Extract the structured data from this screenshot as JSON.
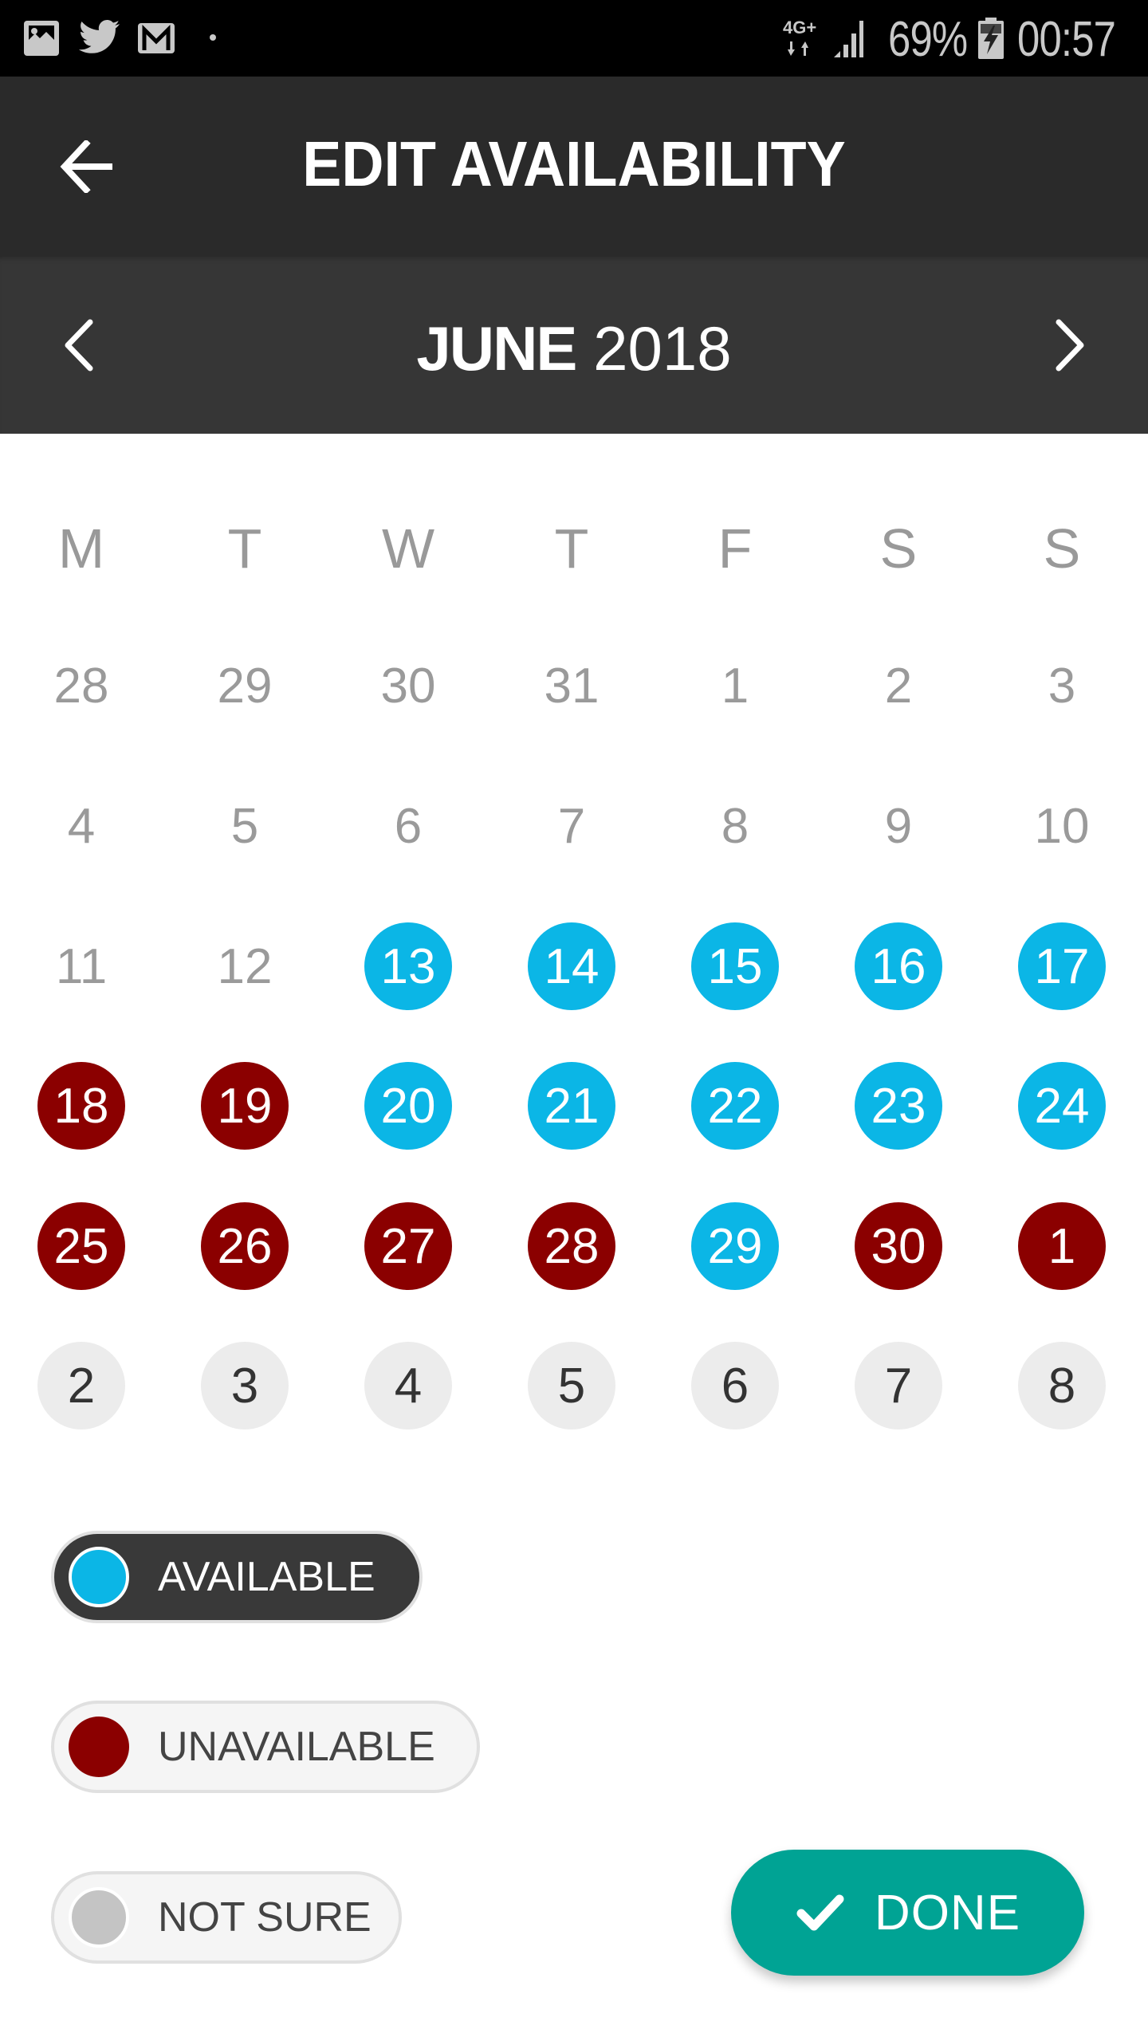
{
  "status_bar": {
    "left_icons": [
      "gallery-icon",
      "twitter-icon",
      "gmail-icon",
      "dot-icon"
    ],
    "network": "4G+",
    "battery_percent": "69%",
    "time": "00:57"
  },
  "header": {
    "title": "EDIT AVAILABILITY",
    "back_icon": "arrow-left-icon"
  },
  "month_bar": {
    "month": "JUNE",
    "year": "2018",
    "prev_icon": "chevron-left-icon",
    "next_icon": "chevron-right-icon"
  },
  "calendar": {
    "weekdays": [
      "M",
      "T",
      "W",
      "T",
      "F",
      "S",
      "S"
    ],
    "weeks": [
      [
        {
          "day": "28",
          "status": "muted"
        },
        {
          "day": "29",
          "status": "muted"
        },
        {
          "day": "30",
          "status": "muted"
        },
        {
          "day": "31",
          "status": "muted"
        },
        {
          "day": "1",
          "status": "muted"
        },
        {
          "day": "2",
          "status": "muted"
        },
        {
          "day": "3",
          "status": "muted"
        }
      ],
      [
        {
          "day": "4",
          "status": "muted"
        },
        {
          "day": "5",
          "status": "muted"
        },
        {
          "day": "6",
          "status": "muted"
        },
        {
          "day": "7",
          "status": "muted"
        },
        {
          "day": "8",
          "status": "muted"
        },
        {
          "day": "9",
          "status": "muted"
        },
        {
          "day": "10",
          "status": "muted"
        }
      ],
      [
        {
          "day": "11",
          "status": "muted"
        },
        {
          "day": "12",
          "status": "muted"
        },
        {
          "day": "13",
          "status": "available"
        },
        {
          "day": "14",
          "status": "available"
        },
        {
          "day": "15",
          "status": "available"
        },
        {
          "day": "16",
          "status": "available"
        },
        {
          "day": "17",
          "status": "available"
        }
      ],
      [
        {
          "day": "18",
          "status": "unavailable"
        },
        {
          "day": "19",
          "status": "unavailable"
        },
        {
          "day": "20",
          "status": "available"
        },
        {
          "day": "21",
          "status": "available"
        },
        {
          "day": "22",
          "status": "available"
        },
        {
          "day": "23",
          "status": "available"
        },
        {
          "day": "24",
          "status": "available"
        }
      ],
      [
        {
          "day": "25",
          "status": "unavailable"
        },
        {
          "day": "26",
          "status": "unavailable"
        },
        {
          "day": "27",
          "status": "unavailable"
        },
        {
          "day": "28",
          "status": "unavailable"
        },
        {
          "day": "29",
          "status": "available"
        },
        {
          "day": "30",
          "status": "unavailable"
        },
        {
          "day": "1",
          "status": "unavailable"
        }
      ],
      [
        {
          "day": "2",
          "status": "next"
        },
        {
          "day": "3",
          "status": "next"
        },
        {
          "day": "4",
          "status": "next"
        },
        {
          "day": "5",
          "status": "next"
        },
        {
          "day": "6",
          "status": "next"
        },
        {
          "day": "7",
          "status": "next"
        },
        {
          "day": "8",
          "status": "next"
        }
      ]
    ]
  },
  "legend": {
    "available": {
      "label": "AVAILABLE",
      "color": "#0bb6e6",
      "selected": true
    },
    "unavailable": {
      "label": "UNAVAILABLE",
      "color": "#8b0000",
      "selected": false
    },
    "not_sure": {
      "label": "NOT SURE",
      "color": "#c4c4c4",
      "selected": false
    }
  },
  "done_button": {
    "label": "DONE",
    "icon": "check-icon",
    "color": "#00a394"
  }
}
